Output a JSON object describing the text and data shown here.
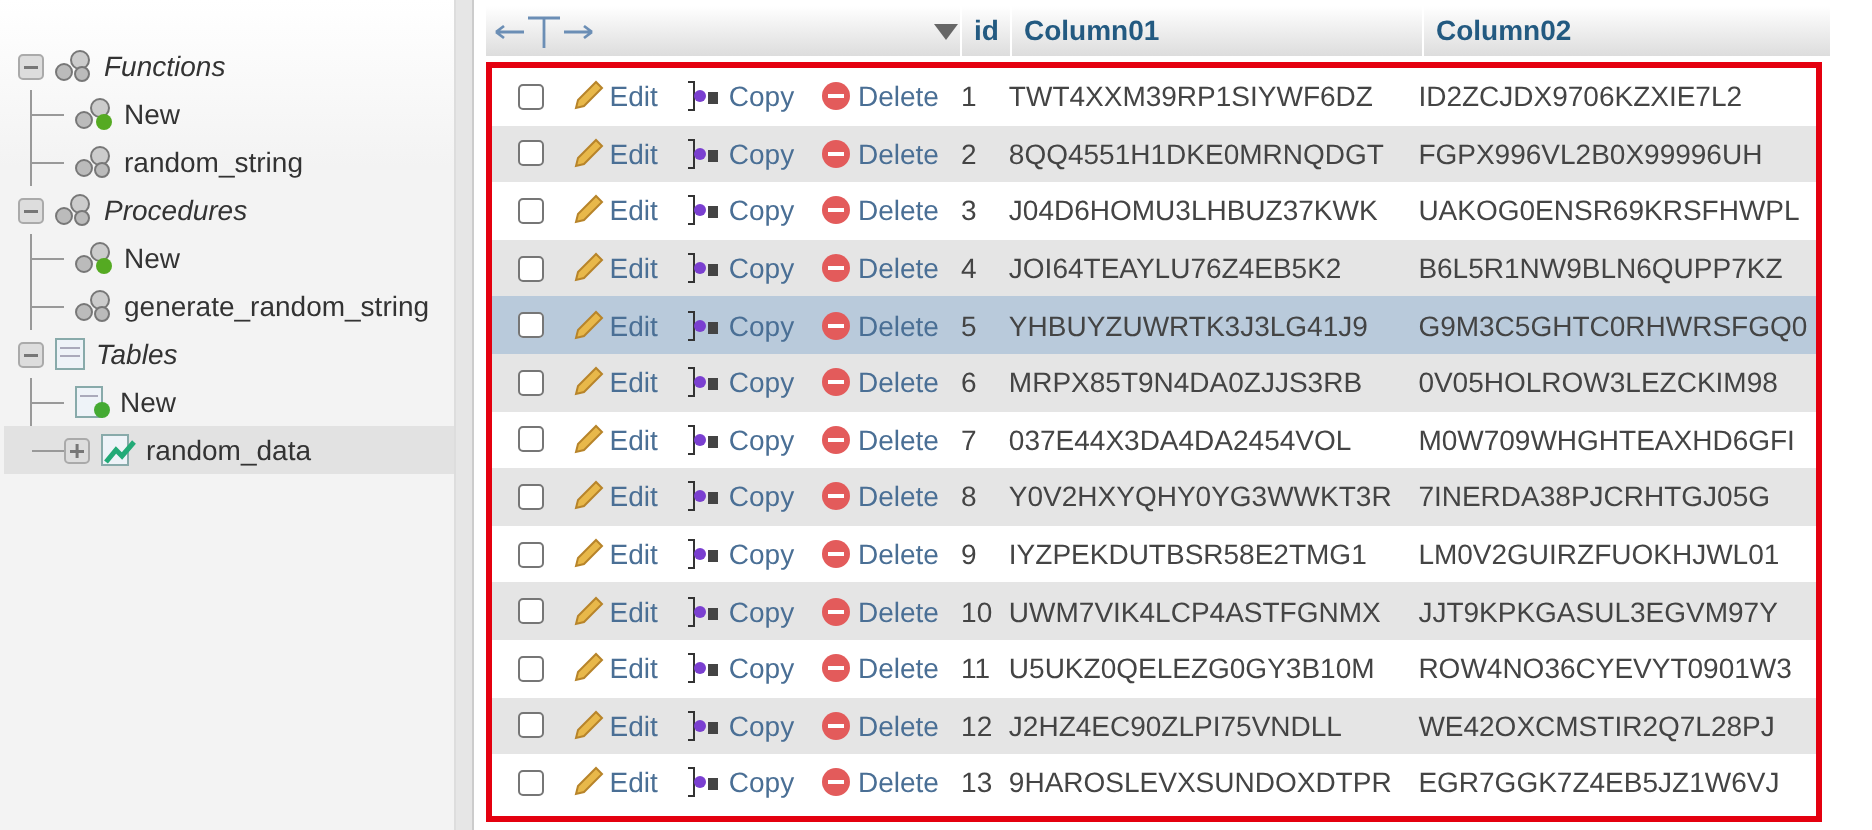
{
  "sidebar": {
    "tree": [
      {
        "label": "Functions",
        "kind": "group",
        "expanded": true,
        "children": [
          {
            "label": "New",
            "kind": "routine-new",
            "selected": false
          },
          {
            "label": "random_string",
            "kind": "routine",
            "selected": false
          }
        ]
      },
      {
        "label": "Procedures",
        "kind": "group",
        "expanded": true,
        "children": [
          {
            "label": "New",
            "kind": "routine-new",
            "selected": false
          },
          {
            "label": "generate_random_string",
            "kind": "routine",
            "selected": false
          }
        ]
      },
      {
        "label": "Tables",
        "kind": "tables",
        "expanded": true,
        "children": [
          {
            "label": "New",
            "kind": "table-new",
            "selected": false
          },
          {
            "label": "random_data",
            "kind": "table",
            "expanded": false,
            "selected": true
          }
        ]
      }
    ]
  },
  "table": {
    "columns": [
      "id",
      "Column01",
      "Column02"
    ],
    "rows": [
      {
        "id": "1",
        "column01": "TWT4XXM39RP1SIYWF6DZ",
        "column02": "ID2ZCJDX9706KZXIE7L2",
        "actions": [
          "Edit",
          "Copy",
          "Delete"
        ],
        "checked": false,
        "selected": false
      },
      {
        "id": "2",
        "column01": "8QQ4551H1DKE0MRNQDGT",
        "column02": "FGPX996VL2B0X99996UH",
        "actions": [
          "Edit",
          "Copy",
          "Delete"
        ],
        "checked": false,
        "selected": false
      },
      {
        "id": "3",
        "column01": "J04D6HOMU3LHBUZ37KWK",
        "column02": "UAKOG0ENSR69KRSFHWPL",
        "actions": [
          "Edit",
          "Copy",
          "Delete"
        ],
        "checked": false,
        "selected": false
      },
      {
        "id": "4",
        "column01": "JOI64TEAYLU76Z4EB5K2",
        "column02": "B6L5R1NW9BLN6QUPP7KZ",
        "actions": [
          "Edit",
          "Copy",
          "Delete"
        ],
        "checked": false,
        "selected": false
      },
      {
        "id": "5",
        "column01": "YHBUYZUWRTK3J3LG41J9",
        "column02": "G9M3C5GHTC0RHWRSFGQ0",
        "actions": [
          "Edit",
          "Copy",
          "Delete"
        ],
        "checked": false,
        "selected": true
      },
      {
        "id": "6",
        "column01": "MRPX85T9N4DA0ZJJS3RB",
        "column02": "0V05HOLROW3LEZCKIM98",
        "actions": [
          "Edit",
          "Copy",
          "Delete"
        ],
        "checked": false,
        "selected": false
      },
      {
        "id": "7",
        "column01": "037E44X3DA4DA2454VOL",
        "column02": "M0W709WHGHTEAXHD6GFI",
        "actions": [
          "Edit",
          "Copy",
          "Delete"
        ],
        "checked": false,
        "selected": false
      },
      {
        "id": "8",
        "column01": "Y0V2HXYQHY0YG3WWKT3R",
        "column02": "7INERDA38PJCRHTGJ05G",
        "actions": [
          "Edit",
          "Copy",
          "Delete"
        ],
        "checked": false,
        "selected": false
      },
      {
        "id": "9",
        "column01": "IYZPEKDUTBSR58E2TMG1",
        "column02": "LM0V2GUIRZFUOKHJWL01",
        "actions": [
          "Edit",
          "Copy",
          "Delete"
        ],
        "checked": false,
        "selected": false
      },
      {
        "id": "10",
        "column01": "UWM7VIK4LCP4ASTFGNMX",
        "column02": "JJT9KPKGASUL3EGVM97Y",
        "actions": [
          "Edit",
          "Copy",
          "Delete"
        ],
        "checked": false,
        "selected": false
      },
      {
        "id": "11",
        "column01": "U5UKZ0QELEZG0GY3B10M",
        "column02": "ROW4NO36CYEVYT0901W3",
        "actions": [
          "Edit",
          "Copy",
          "Delete"
        ],
        "checked": false,
        "selected": false
      },
      {
        "id": "12",
        "column01": "J2HZ4EC90ZLPI75VNDLL",
        "column02": "WE42OXCMSTIR2Q7L28PJ",
        "actions": [
          "Edit",
          "Copy",
          "Delete"
        ],
        "checked": false,
        "selected": false
      },
      {
        "id": "13",
        "column01": "9HAROSLEVXSUNDOXDTPR",
        "column02": "EGR7GGK7Z4EB5JZ1W6VJ",
        "actions": [
          "Edit",
          "Copy",
          "Delete"
        ],
        "checked": false,
        "selected": false
      }
    ]
  }
}
